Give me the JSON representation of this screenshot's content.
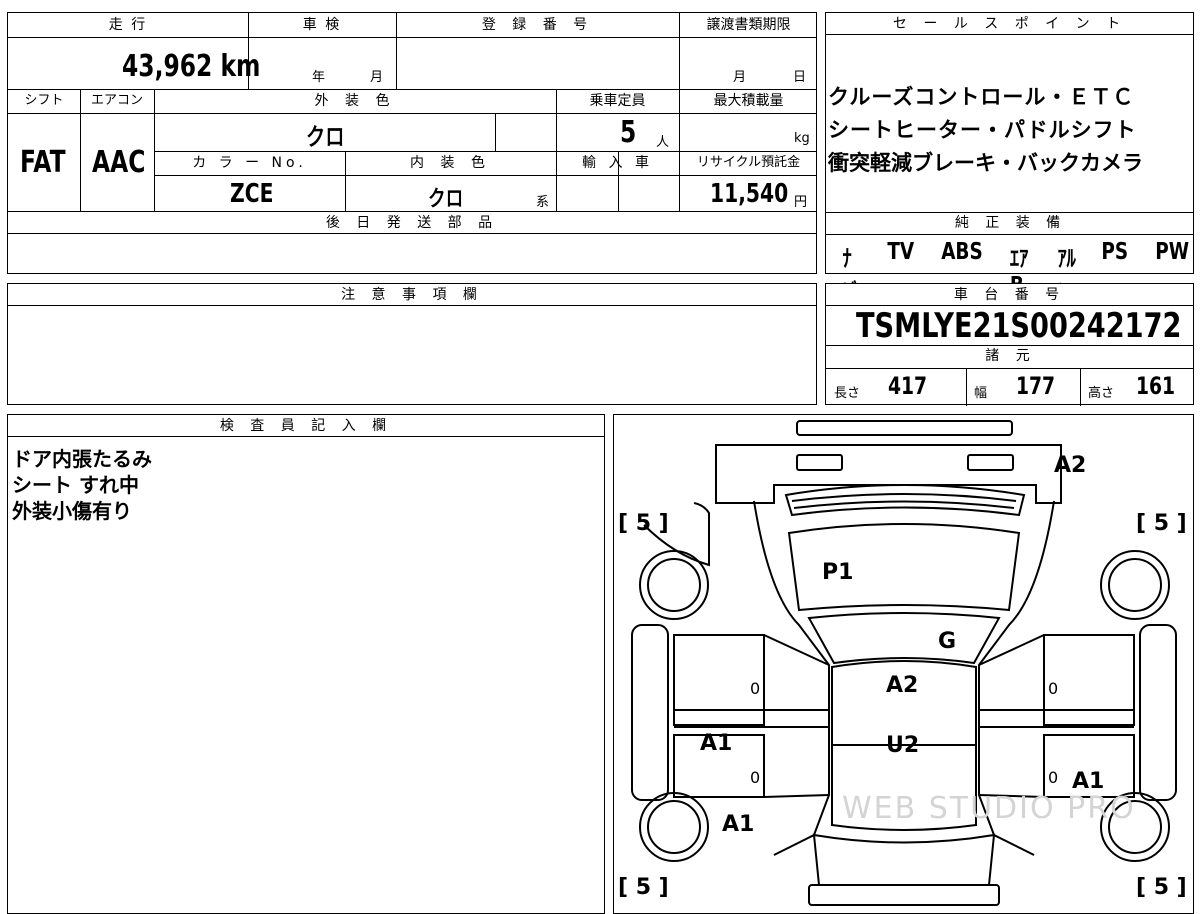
{
  "top": {
    "mileage_label": "走 行",
    "mileage_value": "43,962 km",
    "inspection_label": "車 検",
    "inspection_year": "年",
    "inspection_month": "月",
    "registration_label": "登 録 番 号",
    "transfer_label": "譲渡書類期限",
    "transfer_month": "月",
    "transfer_day": "日"
  },
  "row2": {
    "shift_label": "シフト",
    "shift_value": "FAT",
    "aircon_label": "エアコン",
    "aircon_value": "AAC",
    "ext_color_label": "外 装 色",
    "ext_color_value": "クロ",
    "capacity_label": "乗車定員",
    "capacity_value": "5",
    "capacity_unit": "人",
    "load_label": "最大積載量",
    "load_unit": "kg",
    "color_no_label": "カ ラ ー No.",
    "color_no_value": "ZCE",
    "int_color_label": "内 装 色",
    "int_color_value": "クロ",
    "int_color_suffix": "系",
    "import_label": "輸 入 車",
    "recycle_label": "リサイクル預託金",
    "recycle_value": "11,540",
    "recycle_unit": "円"
  },
  "later_parts_label": "後 日 発 送 部 品",
  "notes_label": "注 意 事 項 欄",
  "inspector_label": "検 査 員 記 入 欄",
  "inspector_lines": [
    "ドア内張たるみ",
    "シート すれ中",
    "外装小傷有り"
  ],
  "sales": {
    "label": "セ ー ル ス ポ イ ン ト",
    "lines": [
      "クルーズコントロール・ＥＴＣ",
      "シートヒーター・パドルシフト",
      "衝突軽減ブレーキ・バックカメラ"
    ]
  },
  "equipment": {
    "label": "純 正 装 備",
    "items": [
      "ﾅﾋﾞ",
      "TV",
      "ABS",
      "ｴｱB",
      "ｱﾙﾐ",
      "PS",
      "PW"
    ]
  },
  "chassis": {
    "label": "車 台 番 号",
    "value": "TSMLYE21S00242172"
  },
  "specs": {
    "label": "諸 元",
    "length_label": "長さ",
    "length_value": "417",
    "width_label": "幅",
    "width_value": "177",
    "height_label": "高さ",
    "height_value": "161"
  },
  "diagram": {
    "tire_fl": "[ 5 ]",
    "tire_fr": "[ 5 ]",
    "tire_rl": "[ 5 ]",
    "tire_rr": "[ 5 ]",
    "front_bumper_mark": "A2",
    "hood_mark": "P1",
    "windshield_mark": "G",
    "roof_mark": "A2",
    "roof2_mark": "U2",
    "left_front_door_mark": "A1",
    "left_rear_mark": "A1",
    "right_rear_mark": "A1",
    "zero_mark": "0",
    "watermark": "WEB STUDIO PRO"
  }
}
